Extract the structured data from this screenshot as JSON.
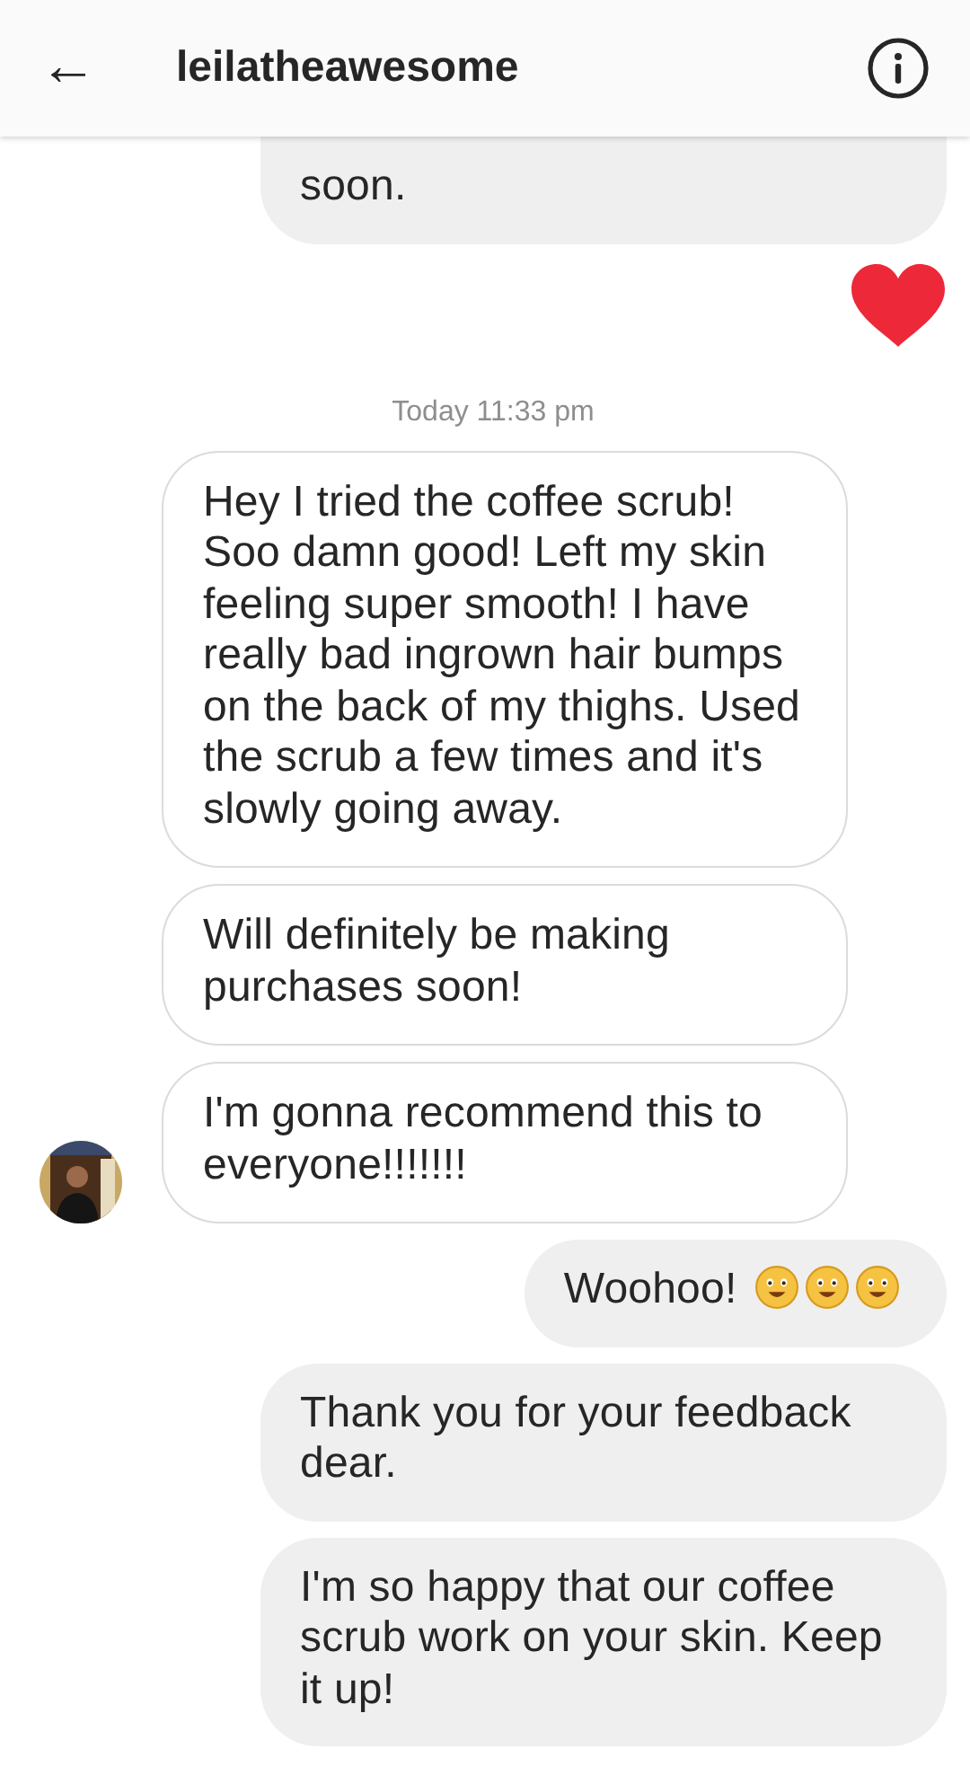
{
  "header": {
    "back": "←",
    "title": "leilatheawesome"
  },
  "messages": [
    {
      "kind": "text",
      "outgoing": true,
      "text": "soon."
    },
    {
      "kind": "heart",
      "outgoing": true
    },
    {
      "kind": "timestamp",
      "text": "Today 11:33 pm"
    },
    {
      "kind": "text",
      "outgoing": false,
      "text": "Hey I tried the coffee scrub! Soo damn good! Left my skin feeling super smooth! I have really bad ingrown hair bumps on the back of my thighs. Used the scrub a few times and it's slowly going away.",
      "avatar": false
    },
    {
      "kind": "text",
      "outgoing": false,
      "text": "Will definitely be making purchases soon!",
      "avatar": false
    },
    {
      "kind": "text",
      "outgoing": false,
      "text": "I'm gonna recommend this to everyone!!!!!!!",
      "avatar": true
    },
    {
      "kind": "text",
      "outgoing": true,
      "text": "Woohoo!",
      "emoji": [
        {
          "kind": "smiley"
        },
        {
          "kind": "smiley"
        },
        {
          "kind": "smiley"
        }
      ]
    },
    {
      "kind": "text",
      "outgoing": true,
      "text": "Thank you for your feedback dear."
    },
    {
      "kind": "text",
      "outgoing": true,
      "text": "I'm so happy that our coffee scrub work on your skin. Keep it up!"
    }
  ]
}
